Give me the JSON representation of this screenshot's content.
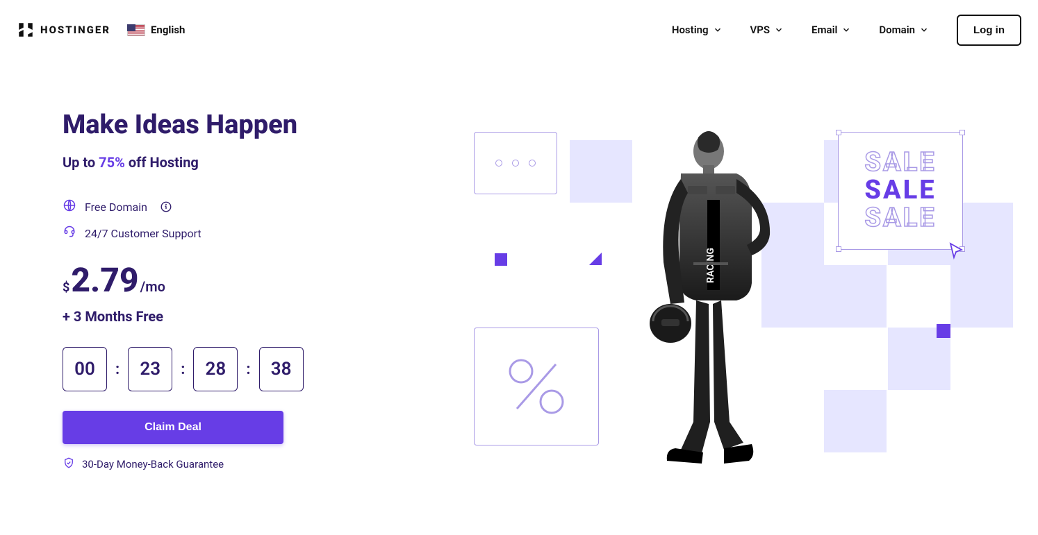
{
  "header": {
    "brand": "HOSTINGER",
    "language": "English",
    "nav": [
      {
        "label": "Hosting"
      },
      {
        "label": "VPS"
      },
      {
        "label": "Email"
      },
      {
        "label": "Domain"
      }
    ],
    "login": "Log in"
  },
  "hero": {
    "headline": "Make Ideas Happen",
    "subhead_prefix": "Up to ",
    "subhead_accent": "75%",
    "subhead_suffix": " off Hosting",
    "features": [
      {
        "icon": "globe-icon",
        "text": "Free Domain",
        "has_info": true
      },
      {
        "icon": "headset-icon",
        "text": "24/7 Customer Support",
        "has_info": false
      }
    ],
    "currency": "$",
    "price": "2.79",
    "per_month": "/mo",
    "bonus": "+ 3 Months Free",
    "countdown": {
      "days": "00",
      "hours": "23",
      "minutes": "28",
      "seconds": "38"
    },
    "cta": "Claim Deal",
    "guarantee": "30-Day Money-Back Guarantee"
  },
  "graphic": {
    "sale_text": "SALE"
  }
}
